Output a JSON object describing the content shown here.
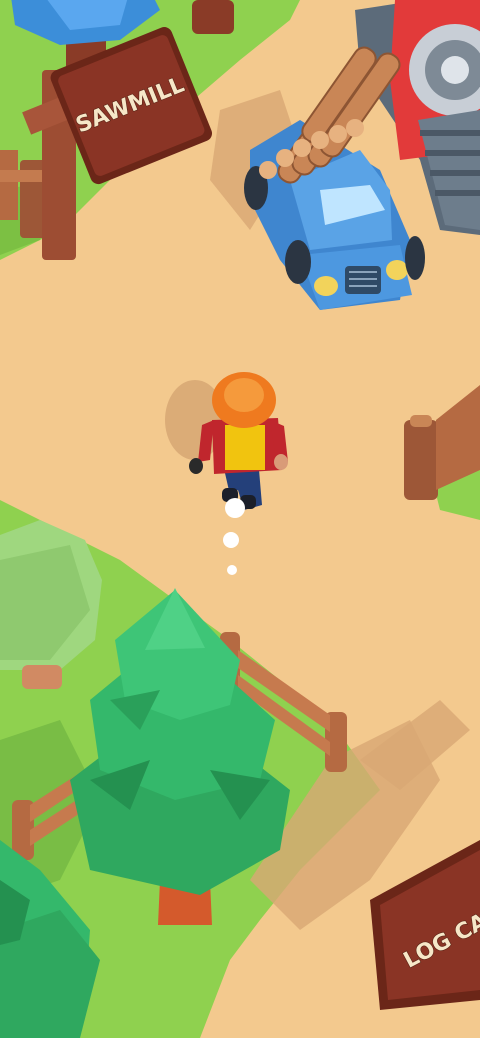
{
  "signs": {
    "sawmill": "SAWMILL",
    "log_cabin": "LOG CA"
  },
  "colors": {
    "dirt": "#f3c98e",
    "grass": "#8fd14f",
    "tree_green": "#34b86b",
    "truck_blue": "#5aa3e6",
    "sawmill_red": "#e23a3a",
    "wood": "#8a4a2f",
    "sign_board": "#7d2f22",
    "hat_orange": "#ef7a1f",
    "shirt_red": "#c0262d"
  }
}
